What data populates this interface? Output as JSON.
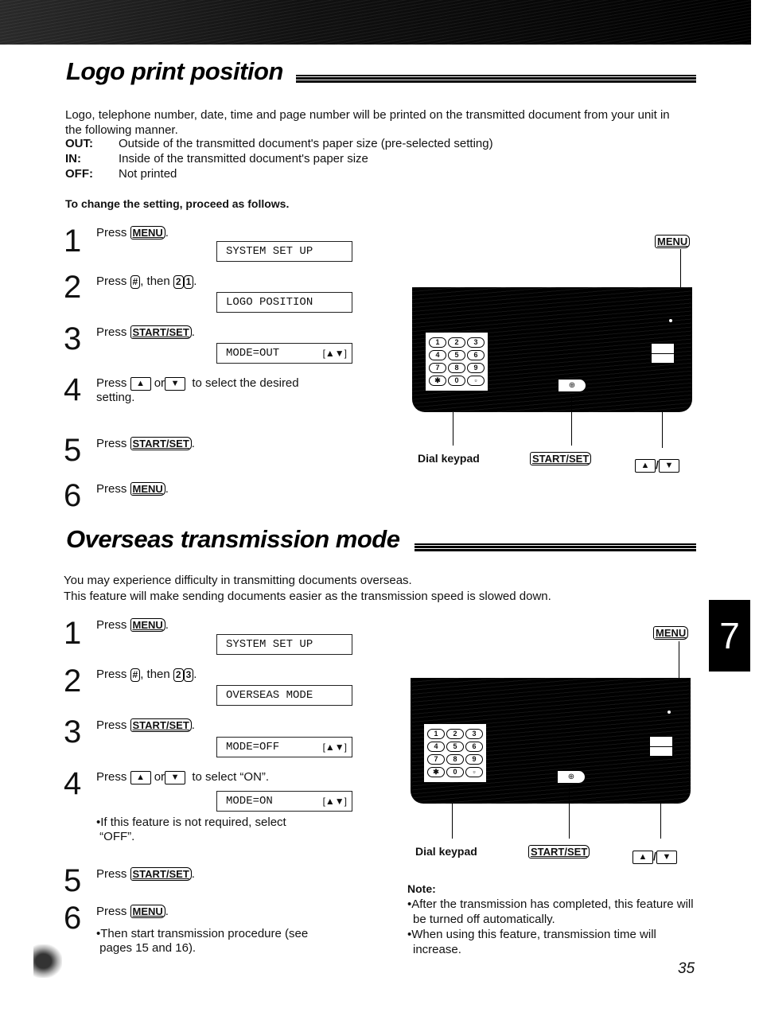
{
  "section1": {
    "title": "Logo print position",
    "intro": "Logo, telephone number, date, time and page number will be printed on the transmitted document from your unit in the following manner.",
    "options": [
      {
        "term": "OUT:",
        "desc": "Outside of the transmitted document's paper size (pre-selected setting)"
      },
      {
        "term": "IN:",
        "desc": "Inside of the transmitted document's paper size"
      },
      {
        "term": "OFF:",
        "desc": "Not printed"
      }
    ],
    "proceed": "To change the setting, proceed as follows.",
    "steps": [
      {
        "num": "1",
        "text": "Press",
        "key": "MENU",
        "after": ".",
        "display": "SYSTEM SET UP"
      },
      {
        "num": "2",
        "text": "Press",
        "key": "#",
        "mid": ", then",
        "keys2": [
          "2",
          "1"
        ],
        "after": ".",
        "display": "LOGO POSITION"
      },
      {
        "num": "3",
        "text": "Press",
        "key": "START/SET",
        "after": ".",
        "display": "MODE=OUT",
        "display_arrows": "[▲▼]"
      },
      {
        "num": "4",
        "text": "Press",
        "up": "▲",
        "or": "or",
        "down": "▼",
        "after": "to select the desired",
        "line2": "setting."
      },
      {
        "num": "5",
        "text": "Press",
        "key": "START/SET",
        "after": "."
      },
      {
        "num": "6",
        "text": "Press",
        "key": "MENU",
        "after": "."
      }
    ]
  },
  "section2": {
    "title": "Overseas transmission mode",
    "intro1": "You may experience difficulty in transmitting documents overseas.",
    "intro2": "This feature will make sending documents easier as the transmission speed is slowed down.",
    "steps": [
      {
        "num": "1",
        "text": "Press",
        "key": "MENU",
        "after": ".",
        "display": "SYSTEM SET UP"
      },
      {
        "num": "2",
        "text": "Press",
        "key": "#",
        "mid": ", then",
        "keys2": [
          "2",
          "3"
        ],
        "after": ".",
        "display": "OVERSEAS MODE"
      },
      {
        "num": "3",
        "text": "Press",
        "key": "START/SET",
        "after": ".",
        "display": "MODE=OFF",
        "display_arrows": "[▲▼]"
      },
      {
        "num": "4",
        "text": "Press",
        "up": "▲",
        "or": "or",
        "down": "▼",
        "after": "to select “ON”.",
        "display": "MODE=ON",
        "display_arrows": "[▲▼]",
        "bullet1": "•If this feature is not required, select",
        "bullet2": "“OFF”."
      },
      {
        "num": "5",
        "text": "Press",
        "key": "START/SET",
        "after": "."
      },
      {
        "num": "6",
        "text": "Press",
        "key": "MENU",
        "after": ".",
        "bullet1": "•Then start transmission procedure (see",
        "bullet2": "pages 15 and 16)."
      }
    ],
    "note": {
      "title": "Note:",
      "bullets": [
        "•After the transmission has completed, this feature will be turned off automatically.",
        "•When using this feature, transmission time will increase."
      ]
    }
  },
  "diagram": {
    "menu_label": "MENU",
    "dial_keypad_label": "Dial keypad",
    "start_set_label": "START/SET",
    "up_label": "▲",
    "slash": "/",
    "down_label": "▼",
    "start_icon": "⊕",
    "keys": [
      "1",
      "2",
      "3",
      "4",
      "5",
      "6",
      "7",
      "8",
      "9",
      "✱",
      "0",
      "▫"
    ]
  },
  "chapter_tab": "7",
  "page_number": "35"
}
